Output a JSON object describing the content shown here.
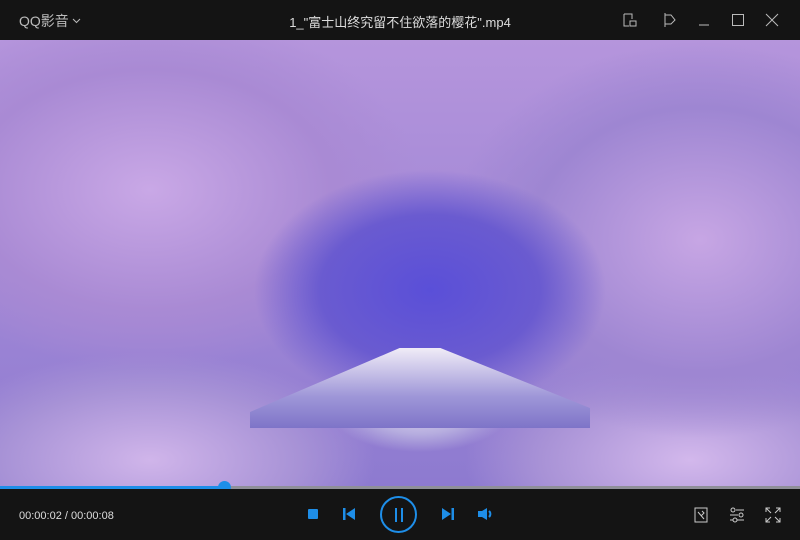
{
  "app": {
    "brand": "QQ影音",
    "title": "1_\"富士山终究留不住欲落的樱花\".mp4"
  },
  "player": {
    "current_time": "00:00:02",
    "separator": " / ",
    "duration": "00:00:08",
    "progress": 0.28,
    "state": "playing"
  },
  "colors": {
    "accent": "#1e8ee8",
    "background": "#141414"
  }
}
